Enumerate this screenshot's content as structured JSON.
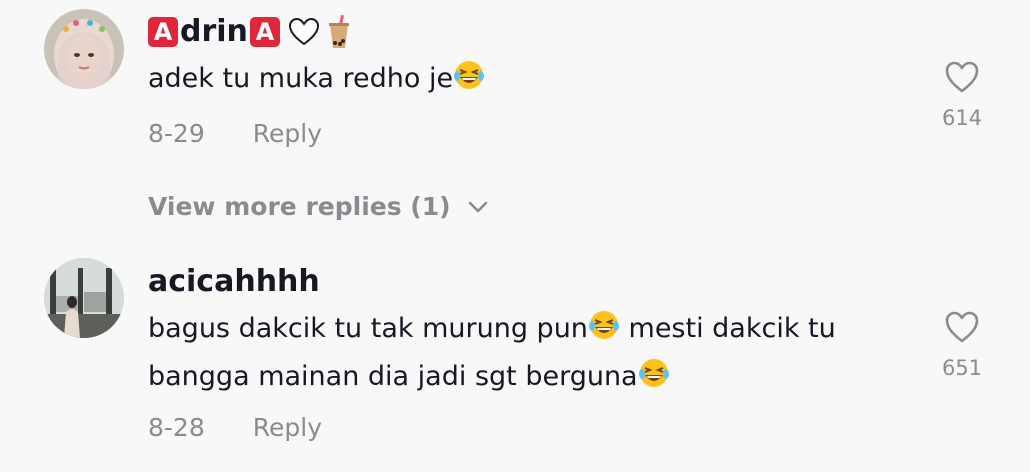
{
  "comments": [
    {
      "username_parts": {
        "badge_left": "A",
        "middle": "drin",
        "badge_right": "A"
      },
      "text": "adek tu muka redho je",
      "date": "8-29",
      "reply_label": "Reply",
      "like_count": "614",
      "icons": [
        "red-a-badge-icon",
        "white-heart-icon",
        "bubble-tea-icon",
        "laughing-tears-emoji"
      ]
    },
    {
      "username": "acicahhhh",
      "text_line1_a": "bagus dakcik tu tak murung pun",
      "text_line1_b": " mesti dakcik tu",
      "text_line2": "bangga mainan dia jadi sgt berguna",
      "date": "8-28",
      "reply_label": "Reply",
      "like_count": "651",
      "icons": [
        "laughing-tears-emoji",
        "heart-outline-icon"
      ]
    }
  ],
  "view_more": {
    "label": "View more replies (1)",
    "icon": "chevron-down-icon"
  },
  "colors": {
    "background": "#f8f8f8",
    "primary_text": "#161823",
    "secondary_text": "#8a8b91",
    "badge_red": "#e0263b"
  }
}
